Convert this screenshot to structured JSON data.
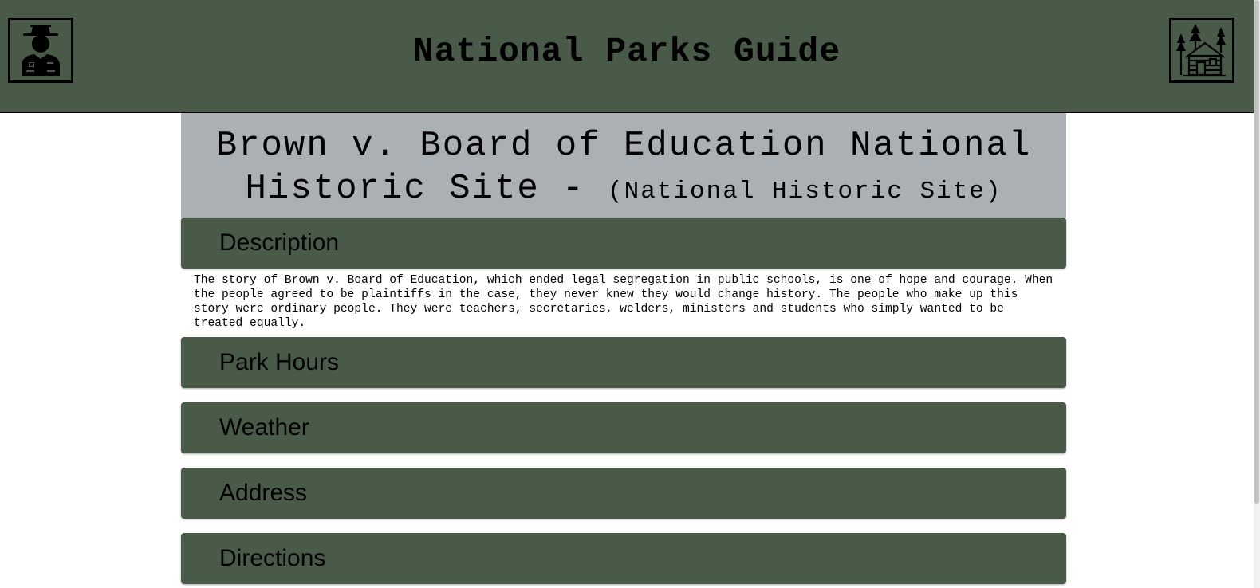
{
  "header": {
    "title": "National Parks Guide",
    "left_icon": "park-ranger-icon",
    "right_icon": "cabin-in-forest-icon",
    "background": "#4a5a49"
  },
  "park": {
    "name": "Brown v. Board of Education National Historic Site -",
    "designation": "(National Historic Site)",
    "title_background": "#aab0b3"
  },
  "sections": {
    "description": {
      "label": "Description",
      "body": "The story of Brown v. Board of Education, which ended legal segregation in public schools, is one of hope and courage. When the people agreed to be plaintiffs in the case, they never knew they would change history. The people who make up this story were ordinary people. They were teachers, secretaries, welders, ministers and students who simply wanted to be treated equally."
    },
    "park_hours": {
      "label": "Park Hours"
    },
    "weather": {
      "label": "Weather"
    },
    "address": {
      "label": "Address"
    },
    "directions": {
      "label": "Directions"
    }
  },
  "colors": {
    "section_header": "#4a5a49",
    "text": "#000000"
  }
}
